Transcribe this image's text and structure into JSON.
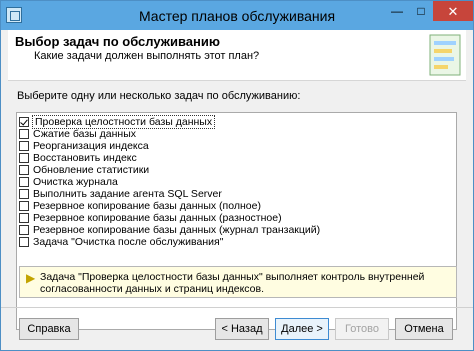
{
  "window": {
    "title": "Мастер планов обслуживания",
    "controls": {
      "minimize": "—",
      "maximize": "□",
      "close": "✕"
    }
  },
  "header": {
    "title": "Выбор задач по обслуживанию",
    "subtitle": "Какие задачи должен выполнять этот план?"
  },
  "body": {
    "prompt": "Выберите одну или несколько задач по обслуживанию:",
    "tasks": [
      {
        "label": "Проверка целостности базы данных",
        "checked": true,
        "selected": true
      },
      {
        "label": "Сжатие базы данных",
        "checked": false
      },
      {
        "label": "Реорганизация индекса",
        "checked": false
      },
      {
        "label": "Восстановить индекс",
        "checked": false
      },
      {
        "label": "Обновление статистики",
        "checked": false
      },
      {
        "label": "Очистка журнала",
        "checked": false
      },
      {
        "label": "Выполнить задание агента SQL Server",
        "checked": false
      },
      {
        "label": "Резервное копирование базы данных (полное)",
        "checked": false
      },
      {
        "label": "Резервное копирование базы данных (разностное)",
        "checked": false
      },
      {
        "label": "Резервное копирование базы данных (журнал транзакций)",
        "checked": false
      },
      {
        "label": "Задача \"Очистка после обслуживания\"",
        "checked": false
      }
    ]
  },
  "info": {
    "text": "Задача \"Проверка целостности базы данных\" выполняет контроль внутренней согласованности данных и страниц индексов."
  },
  "buttons": {
    "help": "Справка",
    "back": "< Назад",
    "next": "Далее >",
    "finish": "Готово",
    "cancel": "Отмена"
  }
}
